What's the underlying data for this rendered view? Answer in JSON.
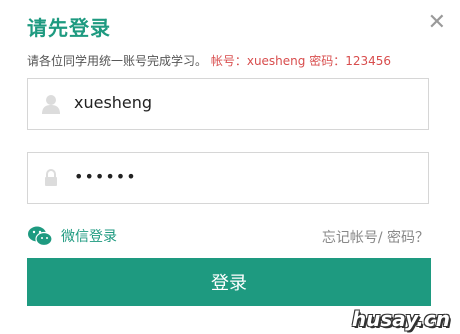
{
  "dialog": {
    "title": "请先登录",
    "notice_text": "请各位同学用统一账号完成学习。",
    "credentials_text": "帐号：xuesheng  密码：123456"
  },
  "icons": {
    "close": "close-icon",
    "user": "user-icon",
    "lock": "lock-icon",
    "wechat": "wechat-icon"
  },
  "form": {
    "username_value": "xuesheng",
    "password_value": "••••••"
  },
  "links": {
    "wechat_login": "微信登录",
    "forgot": "忘记帐号/ 密码？"
  },
  "buttons": {
    "login": "登录"
  },
  "watermark": "husay.cn",
  "colors": {
    "brand": "#1e9a80",
    "credentials": "#d84d4d"
  }
}
